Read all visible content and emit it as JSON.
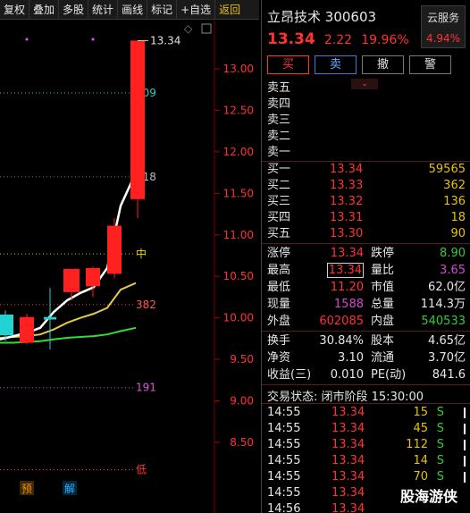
{
  "toolbar": {
    "buttons": [
      "复权",
      "叠加",
      "多股",
      "统计",
      "画线",
      "标记",
      "+自选"
    ],
    "back": "返回"
  },
  "chart": {
    "price_axis": [
      "13.00",
      "12.50",
      "12.00",
      "11.50",
      "11.00",
      "10.50",
      "10.00",
      "9.50",
      "9.00",
      "8.50"
    ],
    "high_label": "13.34",
    "levels": {
      "l809": "809",
      "l618": "618",
      "mid": "中",
      "l382": "382",
      "l191": "191",
      "low": "低"
    },
    "markers": {
      "yu": "预",
      "jie": "解"
    },
    "colors": {
      "up": "#ff2020",
      "down": "#22d3d3",
      "ma_white": "#ffffff",
      "ma_yellow": "#e6c84a",
      "ma_green": "#33dd33"
    }
  },
  "chart_data": {
    "type": "candlestick",
    "ylim": [
      8.3,
      13.6
    ],
    "candles": [
      {
        "open": 9.79,
        "close": 10.04,
        "high": 10.09,
        "low": 9.72,
        "dir": "down"
      },
      {
        "open": 9.7,
        "close": 10.01,
        "high": 10.05,
        "low": 9.68,
        "dir": "up"
      },
      {
        "open": 10.01,
        "close": 9.98,
        "high": 10.36,
        "low": 9.62,
        "dir": "down"
      },
      {
        "open": 10.31,
        "close": 10.59,
        "high": 10.59,
        "low": 10.21,
        "dir": "up"
      },
      {
        "open": 10.38,
        "close": 10.6,
        "high": 10.62,
        "low": 10.25,
        "dir": "up"
      },
      {
        "open": 10.53,
        "close": 11.11,
        "high": 11.2,
        "low": 10.48,
        "dir": "up"
      },
      {
        "open": 11.43,
        "close": 13.34,
        "high": 13.34,
        "low": 11.2,
        "dir": "up"
      }
    ],
    "ma_white": [
      9.74,
      9.78,
      9.82,
      9.88,
      10.07,
      10.21,
      10.3,
      10.37,
      10.6,
      11.35,
      11.75
    ],
    "ma_yellow": [
      9.76,
      9.77,
      9.78,
      9.8,
      9.86,
      9.94,
      10.0,
      10.05,
      10.12,
      10.34,
      10.42
    ],
    "ma_green": [
      9.7,
      9.7,
      9.71,
      9.72,
      9.74,
      9.76,
      9.77,
      9.78,
      9.8,
      9.84,
      9.88
    ],
    "fib_levels": {
      "809": 12.71,
      "618": 11.7,
      "中": 10.77,
      "382": 10.16,
      "191": 9.16,
      "低": 8.17
    }
  },
  "quote": {
    "name": "立昂技术",
    "code": "300603",
    "price": "13.34",
    "change": "2.22",
    "pct": "19.96%",
    "cloud_label": "云服务",
    "cloud_pct": "4.94%",
    "actions": {
      "buy": "买",
      "sell": "卖",
      "cancel": "撤",
      "alert": "警"
    },
    "asks": [
      {
        "label": "卖五"
      },
      {
        "label": "卖四"
      },
      {
        "label": "卖三"
      },
      {
        "label": "卖二"
      },
      {
        "label": "卖一"
      }
    ],
    "bids": [
      {
        "label": "买一",
        "price": "13.34",
        "vol": "59565"
      },
      {
        "label": "买二",
        "price": "13.33",
        "vol": "362"
      },
      {
        "label": "买三",
        "price": "13.32",
        "vol": "136"
      },
      {
        "label": "买四",
        "price": "13.31",
        "vol": "18"
      },
      {
        "label": "买五",
        "price": "13.30",
        "vol": "90"
      }
    ],
    "stats": {
      "limit_up_label": "涨停",
      "limit_up": "13.34",
      "limit_down_label": "跌停",
      "limit_down": "8.90",
      "high_label": "最高",
      "high": "13.34",
      "vol_ratio_label": "量比",
      "vol_ratio": "3.65",
      "low_label": "最低",
      "low": "11.20",
      "mkt_cap_label": "市值",
      "mkt_cap": "62.0亿",
      "cur_vol_label": "现量",
      "cur_vol": "1588",
      "total_vol_label": "总量",
      "total_vol": "114.3万",
      "outer_label": "外盘",
      "outer": "602085",
      "inner_label": "内盘",
      "inner": "540533",
      "turnover_label": "换手",
      "turnover": "30.84%",
      "share_cap_label": "股本",
      "share_cap": "4.65亿",
      "nav_label": "净资",
      "nav": "3.10",
      "float_label": "流通",
      "float": "3.70亿",
      "eps_label": "收益(三)",
      "eps": "0.010",
      "pe_label": "PE(动)",
      "pe": "841.6"
    },
    "status": "交易状态: 闭市阶段 15:30:00",
    "ticks": [
      {
        "time": "14:55",
        "price": "13.34",
        "vol": "15",
        "dir": "S"
      },
      {
        "time": "14:55",
        "price": "13.34",
        "vol": "45",
        "dir": "S"
      },
      {
        "time": "14:55",
        "price": "13.34",
        "vol": "112",
        "dir": "S"
      },
      {
        "time": "14:55",
        "price": "13.34",
        "vol": "14",
        "dir": "S"
      },
      {
        "time": "14:55",
        "price": "13.34",
        "vol": "70",
        "dir": "S"
      },
      {
        "time": "14:55",
        "price": "13.34",
        "vol": "",
        "dir": ""
      },
      {
        "time": "14:56",
        "price": "13.34",
        "vol": "",
        "dir": ""
      }
    ]
  },
  "watermark": "股海游侠"
}
